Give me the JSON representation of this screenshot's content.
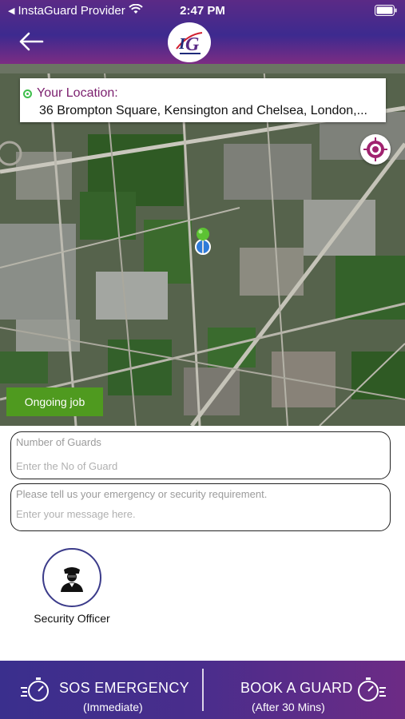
{
  "status_bar": {
    "carrier": "InstaGuard Provider",
    "time": "2:47 PM"
  },
  "nav": {
    "logo_text": "IG"
  },
  "map": {
    "location_label": "Your Location:",
    "address": "36 Brompton Square, Kensington and Chelsea, London,...",
    "ongoing_label": "Ongoing job"
  },
  "form": {
    "guards_title": "Number of Guards",
    "guards_placeholder": "Enter the No of Guard",
    "message_title": "Please tell us your emergency or security requirement.",
    "message_placeholder": "Enter your message here."
  },
  "services": [
    {
      "label": "Security Officer",
      "icon": "security-officer-icon"
    }
  ],
  "bottom_bar": {
    "sos_title": "SOS EMERGENCY",
    "sos_sub": "(Immediate)",
    "book_title": "BOOK A GUARD",
    "book_sub": "(After 30 Mins)"
  },
  "colors": {
    "header_purple": "#5b2a86",
    "accent_magenta": "#7b1f6e",
    "ongoing_green": "#4f9a1f",
    "pin_green": "#5cc233"
  }
}
